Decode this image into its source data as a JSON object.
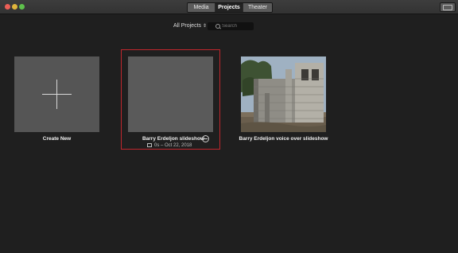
{
  "toolbar": {
    "tabs": [
      {
        "label": "Media",
        "selected": false
      },
      {
        "label": "Projects",
        "selected": true
      },
      {
        "label": "Theater",
        "selected": false
      }
    ]
  },
  "filter": {
    "selected": "All Projects",
    "arrow_glyph": "⇕"
  },
  "search": {
    "placeholder": "Search",
    "value": ""
  },
  "projects": [
    {
      "title": "Create New",
      "icon": "plus-icon"
    },
    {
      "title": "Barry Erdeljon slideshow",
      "duration": "0s",
      "date": "Oct 22, 2018",
      "meta": "0s – Oct 22, 2018",
      "selected": true,
      "icons": [
        "film-icon",
        "share-icon"
      ]
    },
    {
      "title": "Barry Erdeljon voice over slideshow",
      "thumbnail": "unfinished-concrete-block-building-photo"
    }
  ],
  "colors": {
    "background": "#1f1f1f",
    "selection": "#c1272d",
    "tile": "#555555"
  }
}
